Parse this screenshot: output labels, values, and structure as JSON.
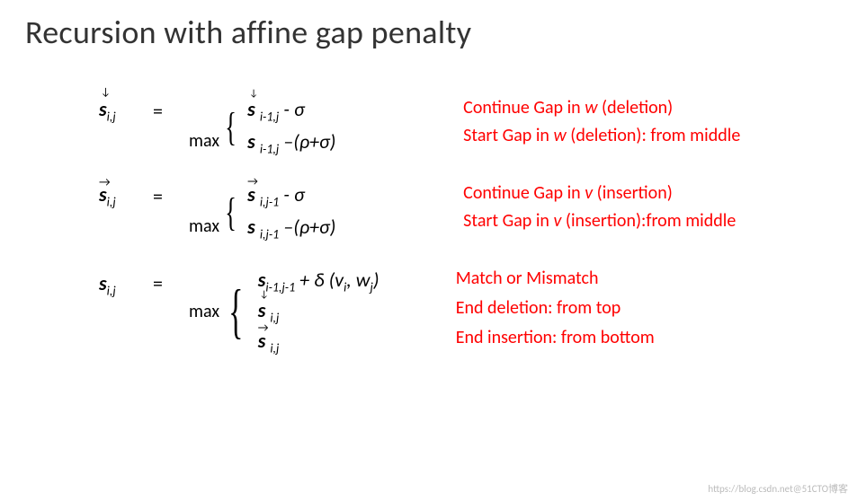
{
  "title": "Recursion with affine gap penalty",
  "blocks": {
    "down": {
      "lhs_sym": "s",
      "lhs_sub": "i,j",
      "arrow_mark": "↓",
      "eq": "=",
      "max": "max",
      "case1_sym": "s",
      "case1_arrow": "↓",
      "case1_sub": "i-1,j",
      "case1_tail": "  - σ",
      "case2_sym": "s",
      "case2_sub": "i-1,j",
      "case2_tail": " –(ρ+σ)",
      "note1_pre": "Continue Gap in ",
      "note1_var": "w",
      "note1_post": " (deletion)",
      "note2_pre": "Start Gap in ",
      "note2_var": "w",
      "note2_post": " (deletion): from middle"
    },
    "right": {
      "lhs_sym": "s",
      "lhs_sub": "i,j",
      "arrow_mark": "→",
      "eq": "=",
      "max": "max",
      "case1_sym": "s",
      "case1_arrow": "→",
      "case1_sub": "i,j-1",
      "case1_tail": "  - σ",
      "case2_sym": "s",
      "case2_sub": "i,j-1",
      "case2_tail": " –(ρ+σ)",
      "note1_pre": "Continue Gap in ",
      "note1_var": "v",
      "note1_post": " (insertion)",
      "note2_pre": "Start Gap in ",
      "note2_var": "v",
      "note2_post": " (insertion):from middle"
    },
    "mid": {
      "lhs_sym": "s",
      "lhs_sub": "i,j",
      "eq": "=",
      "max": "max",
      "case1_sym": "s",
      "case1_sub": "i-1,j-1",
      "case1_tail_a": " + δ (v",
      "case1_tail_asub": "i",
      "case1_tail_b": ",  w",
      "case1_tail_bsub": "j",
      "case1_tail_c": ")",
      "case2_sym": "s",
      "case2_arrow": "↓",
      "case2_sub": "i,j",
      "case3_sym": "s",
      "case3_arrow": "→",
      "case3_sub": "i,j",
      "note1": "Match or Mismatch",
      "note2": "End deletion: from top",
      "note3": "End insertion: from bottom"
    }
  },
  "watermark": "https://blog.csdn.net@51CTO博客"
}
